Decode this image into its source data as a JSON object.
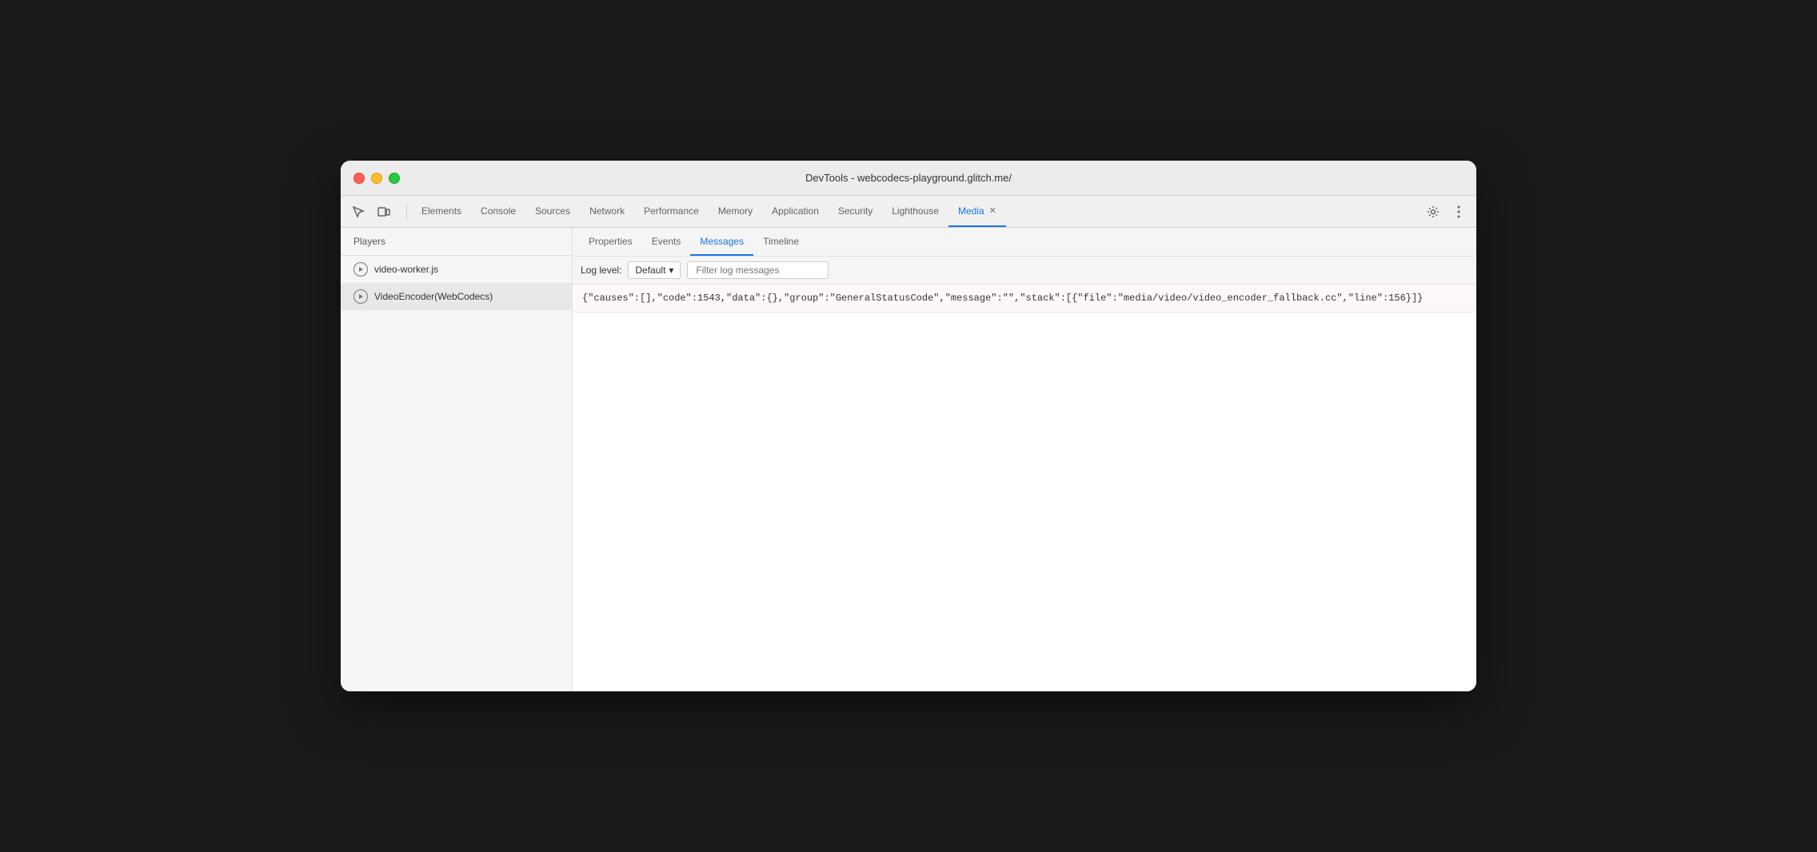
{
  "window": {
    "title": "DevTools - webcodecs-playground.glitch.me/"
  },
  "toolbar": {
    "tabs": [
      {
        "label": "Elements",
        "active": false
      },
      {
        "label": "Console",
        "active": false
      },
      {
        "label": "Sources",
        "active": false
      },
      {
        "label": "Network",
        "active": false
      },
      {
        "label": "Performance",
        "active": false
      },
      {
        "label": "Memory",
        "active": false
      },
      {
        "label": "Application",
        "active": false
      },
      {
        "label": "Security",
        "active": false
      },
      {
        "label": "Lighthouse",
        "active": false
      },
      {
        "label": "Media",
        "active": true,
        "closeable": true
      }
    ]
  },
  "sidebar": {
    "header": "Players",
    "items": [
      {
        "label": "video-worker.js",
        "active": false
      },
      {
        "label": "VideoEncoder(WebCodecs)",
        "active": true
      }
    ]
  },
  "panel": {
    "tabs": [
      {
        "label": "Properties",
        "active": false
      },
      {
        "label": "Events",
        "active": false
      },
      {
        "label": "Messages",
        "active": true
      },
      {
        "label": "Timeline",
        "active": false
      }
    ],
    "log_controls": {
      "label": "Log level:",
      "select_value": "Default",
      "filter_placeholder": "Filter log messages"
    },
    "log_entries": [
      {
        "text": "{\"causes\":[],\"code\":1543,\"data\":{},\"group\":\"GeneralStatusCode\",\"message\":\"\",\"stack\":[{\"file\":\"media/video/video_encoder_fallback.cc\",\"line\":156}]}"
      }
    ]
  }
}
